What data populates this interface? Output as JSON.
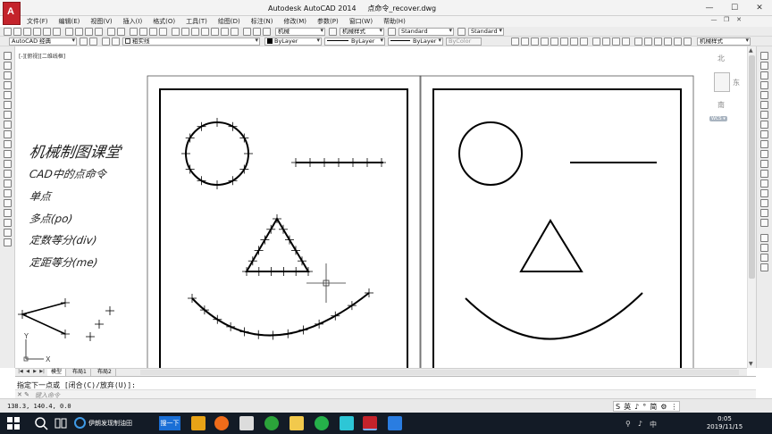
{
  "window": {
    "app_title": "Autodesk AutoCAD 2014",
    "file_name": "点命令_recover.dwg",
    "logo_letter": "A",
    "minimize": "—",
    "maximize": "☐",
    "close": "✕"
  },
  "menu": {
    "items": [
      "文件(F)",
      "编辑(E)",
      "视图(V)",
      "插入(I)",
      "格式(O)",
      "工具(T)",
      "绘图(D)",
      "标注(N)",
      "修改(M)",
      "参数(P)",
      "窗口(W)",
      "帮助(H)"
    ],
    "mdi_minimize": "—",
    "mdi_restore": "❐",
    "mdi_close": "✕"
  },
  "toolbar1": {
    "layer_combo": "机械",
    "text_style": "机械样式",
    "dim_style": "Standard",
    "table_style": "Standard"
  },
  "toolbar2": {
    "workspace": "AutoCAD 经典",
    "layer": "粗实线",
    "color": "ByLayer",
    "linetype": "ByLayer",
    "lineweight": "ByLayer",
    "plotstyle": "ByColor",
    "mleader_style": "机械样式"
  },
  "canvas": {
    "view_label": "[-][俯视][二维线框]",
    "notes": [
      "机械制图课堂",
      "CAD中的点命令",
      "单点",
      "多点(po)",
      "定数等分(div)",
      "定距等分(me)"
    ],
    "axis_x": "X",
    "axis_y": "Y"
  },
  "viewcube": {
    "north": "北",
    "east": "东",
    "south": "南",
    "wcs": "WCS ▾"
  },
  "layout_tabs": {
    "tabs": [
      "模型",
      "布局1",
      "布局2"
    ]
  },
  "command": {
    "history": "指定下一点或 [闭合(C)/放弃(U)]:",
    "prompt_x": "✕ ✎",
    "input_placeholder": "键入命令"
  },
  "status": {
    "coordinates": "138.3, 140.4, 0.0",
    "ime": [
      "S",
      "英",
      "♪",
      "°",
      "简",
      "⚙",
      "⋮"
    ]
  },
  "taskbar": {
    "browser_title": "伊朗发现制油田",
    "search_label": "搜一下",
    "time": "0:05",
    "date": "2019/11/15",
    "tray_icons": [
      "⚲",
      "♪",
      "中"
    ]
  },
  "colors": {
    "accent": "#c4232b",
    "taskbar": "#131b26",
    "taskbar_search": "#1a6fd6"
  }
}
